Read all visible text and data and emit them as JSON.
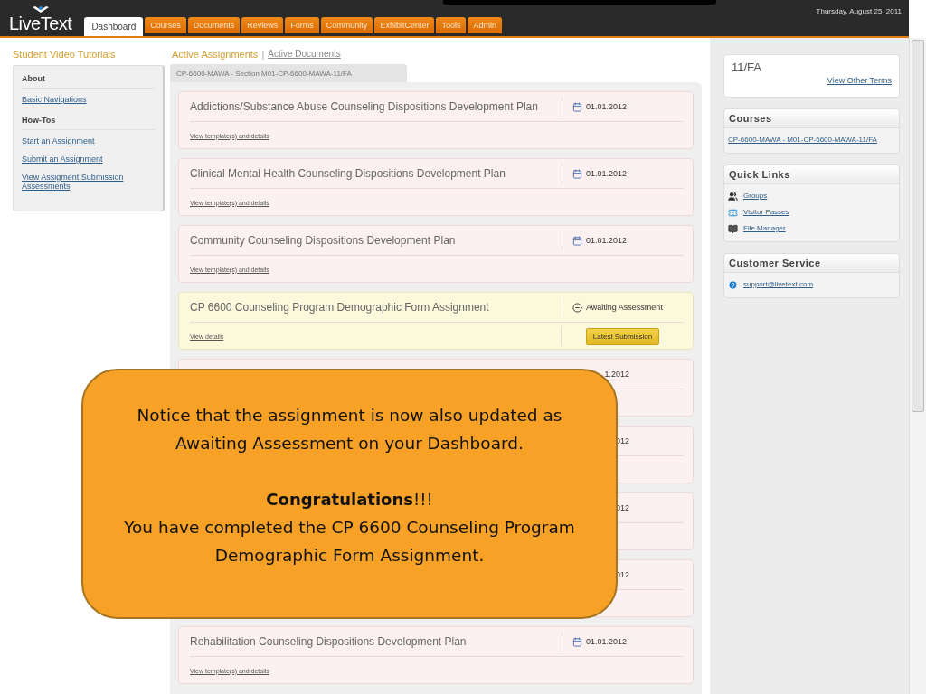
{
  "header": {
    "logo": "LiveText",
    "date": "Thursday, August 25, 2011"
  },
  "tabs": [
    {
      "label": "Dashboard",
      "selected": true
    },
    {
      "label": "Courses",
      "selected": false
    },
    {
      "label": "Documents",
      "selected": false
    },
    {
      "label": "Reviews",
      "selected": false
    },
    {
      "label": "Forms",
      "selected": false
    },
    {
      "label": "Community",
      "selected": false
    },
    {
      "label": "ExhibitCenter",
      "selected": false
    },
    {
      "label": "Tools",
      "selected": false
    },
    {
      "label": "Admin",
      "selected": false
    }
  ],
  "sidebar": {
    "title": "Student Video Tutorials",
    "sections": [
      {
        "heading": "About",
        "links": [
          "Basic Navigations"
        ]
      },
      {
        "heading": "How-Tos",
        "links": [
          "Start an Assignment",
          "Submit an Assignment",
          "View Assigment Submission Assessments"
        ]
      }
    ]
  },
  "main": {
    "views": [
      {
        "label": "Active Assignments",
        "selected": true
      },
      {
        "label": "Active Documents",
        "selected": false
      }
    ],
    "separator": "|",
    "section": "CP-6600-MAWA - Section M01-CP-6600-MAWA-11/FA",
    "cards": [
      {
        "kind": "date",
        "title": "Addictions/Substance Abuse Counseling Dispositions Development Plan",
        "link": "View template(s) and details",
        "date": "01.01.2012"
      },
      {
        "kind": "date",
        "title": "Clinical Mental Health Counseling Dispositions Development Plan",
        "link": "View template(s) and details",
        "date": "01.01.2012"
      },
      {
        "kind": "date",
        "title": "Community Counseling Dispositions Development Plan",
        "link": "View template(s) and details",
        "date": "01.01.2012"
      },
      {
        "kind": "status",
        "title": "CP 6600 Counseling Program Demographic Form Assignment",
        "link": "View details",
        "status": "Awaiting Assessment",
        "button": "Latest Submission"
      },
      {
        "kind": "covered",
        "date": "1.2012"
      },
      {
        "kind": "covered",
        "date": "012"
      },
      {
        "kind": "covered",
        "date": "012"
      },
      {
        "kind": "covered",
        "date": "012"
      },
      {
        "kind": "date",
        "title": "Rehabilitation Counseling Dispositions Development Plan",
        "link": "View template(s) and details",
        "date": "01.01.2012"
      }
    ]
  },
  "right": {
    "term": "11/FA",
    "term_link": "View Other Terms",
    "courses": {
      "title": "Courses",
      "links": [
        "CP-6600-MAWA - M01-CP-6600-MAWA-11/FA"
      ]
    },
    "quick_links": {
      "title": "Quick Links",
      "items": [
        {
          "kind": "groups",
          "label": "Groups"
        },
        {
          "kind": "passes",
          "label": "Visitor Passes"
        },
        {
          "kind": "files",
          "label": "File Manager"
        }
      ]
    },
    "service": {
      "title": "Customer Service",
      "link": "support@livetext.com"
    }
  },
  "callout": {
    "notice": "Notice that the assignment is now also updated as Awaiting Assessment on your Dashboard.",
    "heading": "**Congratulations**!!!",
    "message": "You have completed the CP 6600 Counseling Program Demographic Form Assignment."
  }
}
